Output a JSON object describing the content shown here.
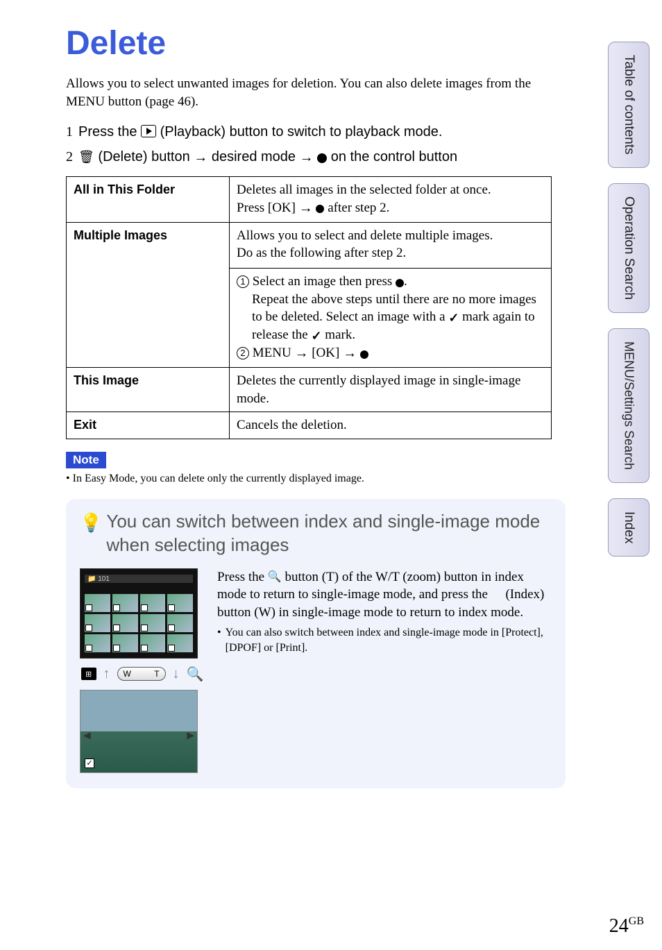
{
  "sidebar": {
    "tabs": [
      {
        "label": "Table of contents"
      },
      {
        "label": "Operation Search"
      },
      {
        "label": "MENU/Settings Search"
      },
      {
        "label": "Index"
      }
    ]
  },
  "title": "Delete",
  "intro": "Allows you to select unwanted images for deletion. You can also delete images from the MENU button (page 46).",
  "steps": {
    "s1_num": "1",
    "s1_a": "Press the ",
    "s1_b": " (Playback) button to switch to playback mode.",
    "s2_num": "2",
    "s2_a": " (Delete) button ",
    "s2_b": " desired mode ",
    "s2_c": " on the control button"
  },
  "table": {
    "r1k": "All in This Folder",
    "r1v_a": "Deletes all images in the selected folder at once.",
    "r1v_b_pre": "Press [OK] ",
    "r1v_b_post": " after step 2.",
    "r2k": "Multiple Images",
    "r2v_a": "Allows you to select and delete multiple images.",
    "r2v_b": "Do as the following after step 2.",
    "r2_1a": "Select an image then press ",
    "r2_1b": ".",
    "r2_1c": "Repeat the above steps until there are no more images to be deleted. Select an image with a ",
    "r2_1d": " mark again to release the ",
    "r2_1e": " mark.",
    "r2_2a": "MENU ",
    "r2_2b": " [OK] ",
    "r3k": "This Image",
    "r3v": "Deletes the currently displayed image in single-image mode.",
    "r4k": "Exit",
    "r4v": "Cancels the deletion."
  },
  "note": {
    "label": "Note",
    "text": "In Easy Mode, you can delete only the currently displayed image."
  },
  "tip": {
    "title": "You can switch between index and single-image mode when selecting images",
    "body_a": "Press the ",
    "body_b": " button (T) of the W/T (zoom) button in index mode to return to single-image mode, and press the ",
    "body_c": " (Index) button (W) in single-image mode to return to index mode.",
    "bullet": "You can also switch between index and single-image mode in [Protect], [DPOF] or [Print].",
    "thumb_header": "📁 101",
    "zoom_w": "W",
    "zoom_t": "T"
  },
  "page_number": "24",
  "page_suffix": "GB"
}
